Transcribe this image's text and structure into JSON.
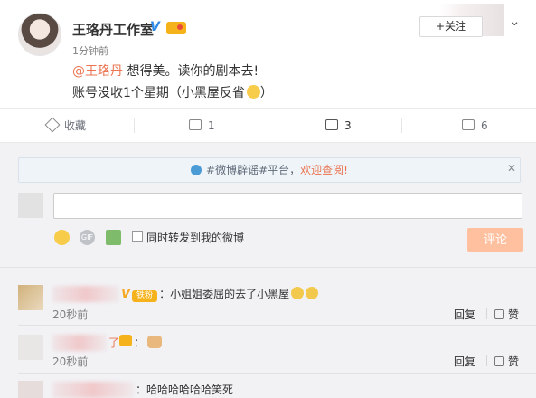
{
  "post": {
    "author": "王珞丹工作室",
    "verified_mark": "V",
    "time": "1分钟前",
    "follow_label": "+关注",
    "text_mention": "@王珞丹",
    "text_line1_rest": " 想得美。读你的剧本去!",
    "text_line2": "账号没收1个星期（小黑屋反省",
    "text_line2_end": "）",
    "chevron_icon": "chevron-down-icon"
  },
  "actions": {
    "favorite_label": "收藏",
    "forward_count": "1",
    "comment_count": "3",
    "like_count": "6"
  },
  "comments_area": {
    "notice_prefix": "#微博辟谣#平台，",
    "notice_highlight": "欢迎查阅!",
    "notice_close": "✕",
    "forward_also_label": "同时转发到我的微博",
    "submit_label": "评论"
  },
  "comments": [
    {
      "badge_v": "V",
      "fan_badge": "铁粉",
      "text": "：小姐姐委屈的去了小黑屋",
      "time": "20秒前",
      "reply": "回复",
      "like": "赞"
    },
    {
      "text_prefix": "了",
      "text": "：",
      "time": "20秒前",
      "reply": "回复",
      "like": "赞"
    },
    {
      "text": "：哈哈哈哈哈哈笑死"
    }
  ],
  "colors": {
    "accent_orange": "#eb7350",
    "verified_blue": "#2d8ae6",
    "submit_disabled": "#ffc09f",
    "panel_bg": "#f2f2f5"
  }
}
